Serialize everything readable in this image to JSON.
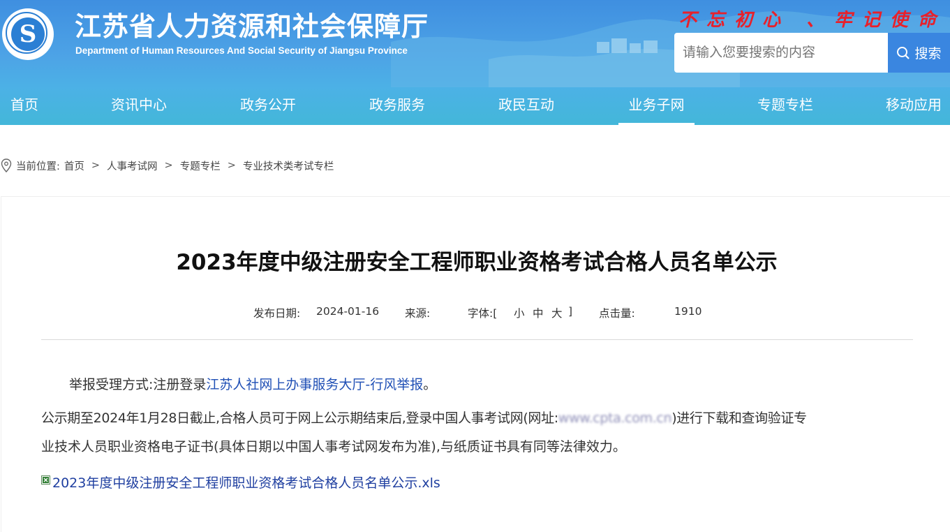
{
  "header": {
    "site_title_cn": "江苏省人力资源和社会保障厅",
    "site_title_en": "Department of Human Resources And Social Security of Jiangsu Province",
    "slogan": "不忘初心 、牢记使命",
    "logo_text": "江苏省人力资源和社会保障厅",
    "search": {
      "placeholder": "请输入您要搜索的内容",
      "button_label": "搜索"
    }
  },
  "nav": {
    "items": [
      {
        "label": "首页"
      },
      {
        "label": "资讯中心"
      },
      {
        "label": "政务公开"
      },
      {
        "label": "政务服务"
      },
      {
        "label": "政民互动"
      },
      {
        "label": "业务子网"
      },
      {
        "label": "专题专栏"
      },
      {
        "label": "移动应用"
      }
    ],
    "active": "业务子网"
  },
  "breadcrumb": {
    "prefix": "当前位置:",
    "items": [
      "首页",
      "人事考试网",
      "专题专栏",
      "专业技术类考试专栏"
    ],
    "separator": ">"
  },
  "article": {
    "title": "2023年度中级注册安全工程师职业资格考试合格人员名单公示",
    "meta": {
      "date_label": "发布日期:",
      "date": "2024-01-16",
      "source_label": "来源:",
      "font_label": "字体:[",
      "font_small": "小",
      "font_medium": "中",
      "font_large": "大",
      "font_close": "]",
      "views_label": "点击量:",
      "views": "1910"
    },
    "report": {
      "prefix": "举报受理方式:注册登录",
      "link": "江苏人社网上办事服务大厅-行风举报",
      "suffix": "。"
    },
    "notice": {
      "line1_before": "公示期至2024年1月28日截止,合格人员可于网上公示期结束后,登录中国人事考试网(网址:",
      "url_blurred": "www.cpta.com.cn",
      "line1_after": ")进行下载和查询验证专",
      "line2": "业技术人员职业资格电子证书(具体日期以中国人事考试网发布为准),与纸质证书具有同等法律效力。"
    },
    "attachment": "2023年度中级注册安全工程师职业资格考试合格人员名单公示.xls"
  },
  "colors": {
    "header_blue": "#4da3e6",
    "search_button": "#3a86e0",
    "slogan_red": "#e8202a",
    "link_blue": "#1f4fb5"
  }
}
